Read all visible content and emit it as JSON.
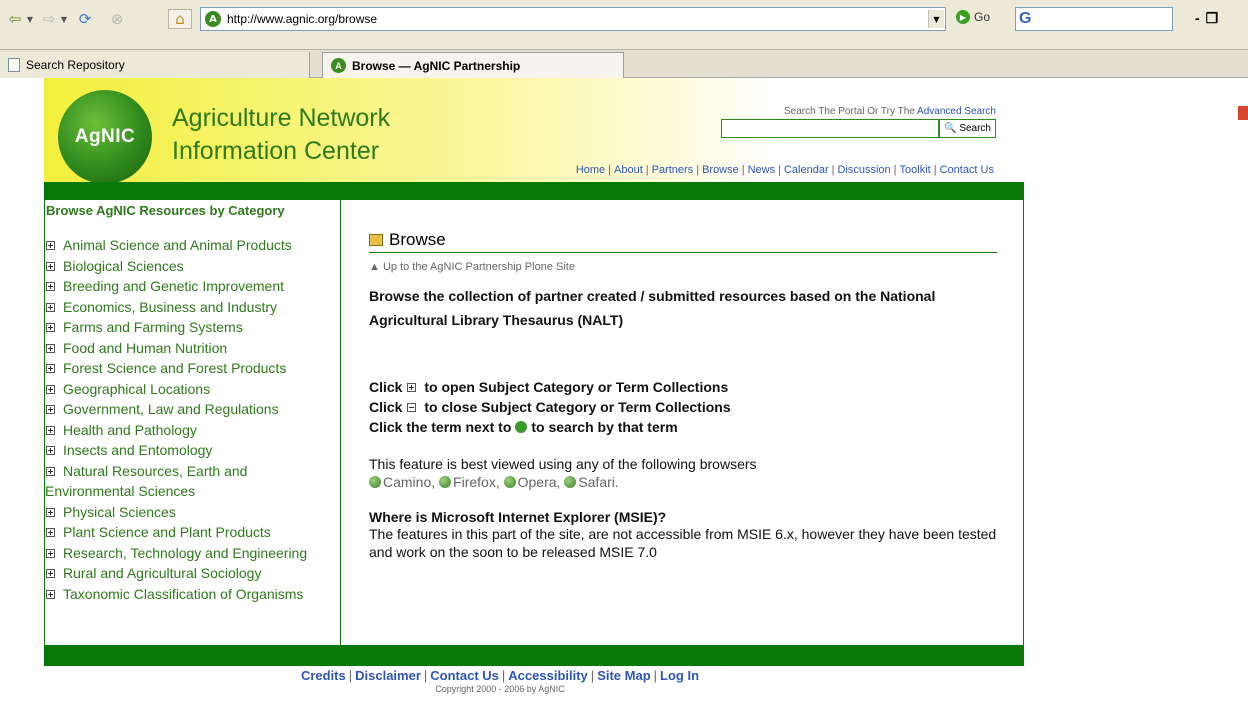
{
  "browser": {
    "url": "http://www.agnic.org/browse",
    "go_label": "Go",
    "google_glyph": "G",
    "tabs": [
      {
        "label": "Search Repository",
        "icon": "document-icon"
      },
      {
        "label": "Browse — AgNIC Partnership",
        "icon": "site-icon"
      }
    ]
  },
  "header": {
    "logo_text": "AgNIC",
    "site_name_line1": "Agriculture Network",
    "site_name_line2": "Information Center",
    "search_hint": "Search The Portal Or Try The",
    "advanced_search": "Advanced Search",
    "search_button": "Search",
    "nav": [
      "Home",
      "About",
      "Partners",
      "Browse",
      "News",
      "Calendar",
      "Discussion",
      "Toolkit",
      "Contact Us"
    ]
  },
  "sidebar": {
    "title": "Browse AgNIC Resources by Category",
    "categories": [
      "Animal Science and Animal Products",
      "Biological Sciences",
      "Breeding and Genetic Improvement",
      "Economics, Business and Industry",
      "Farms and Farming Systems",
      "Food and Human Nutrition",
      "Forest Science and Forest Products",
      "Geographical Locations",
      "Government, Law and Regulations",
      "Health and Pathology",
      "Insects and Entomology",
      "Natural Resources, Earth and Environmental Sciences",
      "Physical Sciences",
      "Plant Science and Plant Products",
      "Research, Technology and Engineering",
      "Rural and Agricultural Sociology",
      "Taxonomic Classification of Organisms"
    ]
  },
  "main": {
    "title": "Browse",
    "up_link": "Up to the AgNIC Partnership Plone Site",
    "intro": "Browse the collection of partner created / submitted resources based on the National Agricultural Library Thesaurus (NALT)",
    "click_word": "Click",
    "open_text": "to open Subject Category or Term Collections",
    "close_text": "to close Subject Category or Term Collections",
    "term_text_a": "Click the term next to",
    "term_text_b": "to search by that term",
    "feature_text": "This feature is best viewed using any of the following browsers",
    "browsers": [
      "Camino,",
      "Firefox,",
      "Opera,",
      "Safari."
    ],
    "msie_heading": "Where is Microsoft Internet Explorer (MSIE)?",
    "msie_text": "The features in this part of the site, are not accessible from MSIE 6.x, however they have been tested and work on the soon to be released MSIE 7.0"
  },
  "footer": {
    "links": [
      "Credits",
      "Disclaimer",
      "Contact Us",
      "Accessibility",
      "Site Map",
      "Log In"
    ],
    "copyright": "Copyright 2000 - 2006 by AgNIC"
  }
}
